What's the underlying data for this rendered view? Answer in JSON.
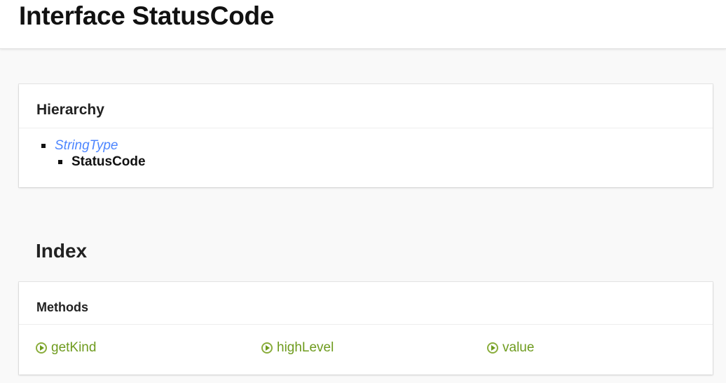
{
  "header": {
    "title": "Interface StatusCode"
  },
  "hierarchy": {
    "title": "Hierarchy",
    "parent": "StringType",
    "current": "StatusCode"
  },
  "index": {
    "title": "Index",
    "methods_title": "Methods",
    "methods": [
      "getKind",
      "highLevel",
      "value"
    ]
  },
  "colors": {
    "link": "#4d86ff",
    "method": "#6e9b1e"
  }
}
